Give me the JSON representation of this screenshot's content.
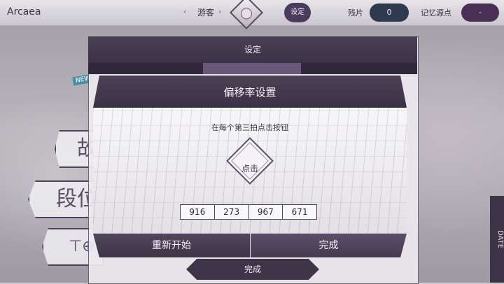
{
  "topbar": {
    "brand": "Arcaea",
    "nav_left": "‹",
    "user_name": "游客",
    "nav_right": "›",
    "settings_label": "设定",
    "shards_label": "残片",
    "shards_value": "0",
    "memory_label": "记忆源点",
    "memory_value": "-"
  },
  "background": {
    "new_badge": "NEW",
    "menu_items": [
      "故",
      "段位",
      "⊤⊕"
    ],
    "side_banner": "DATE"
  },
  "settings_panel": {
    "title": "设定",
    "done_label": "完成"
  },
  "offset_dialog": {
    "title": "偏移率设置",
    "instruction": "在每个第三拍点击按钮",
    "tap_label": "点击",
    "numbers": [
      "916",
      "273",
      "967",
      "671"
    ],
    "restart_label": "重新开始",
    "done_label": "完成"
  },
  "colors": {
    "header": "#3b3345",
    "accent": "#4b3c5e",
    "shards_bg": "#2f3a4f",
    "memory_bg": "#4a2f55"
  }
}
